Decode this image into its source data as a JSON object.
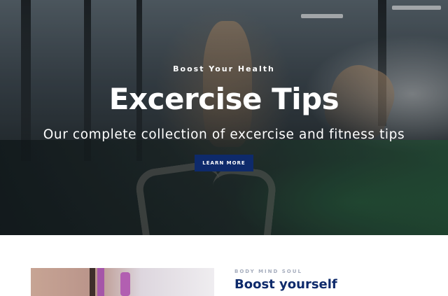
{
  "hero": {
    "eyebrow": "Boost Your Health",
    "title": "Excercise Tips",
    "subtitle": "Our complete collection of excercise and fitness tips",
    "cta_label": "LEARN MORE",
    "cta_color": "#0e2a6b"
  },
  "feature": {
    "kicker": "BODY MIND SOUL",
    "title": "Boost yourself",
    "title_color": "#0e2a6b"
  }
}
